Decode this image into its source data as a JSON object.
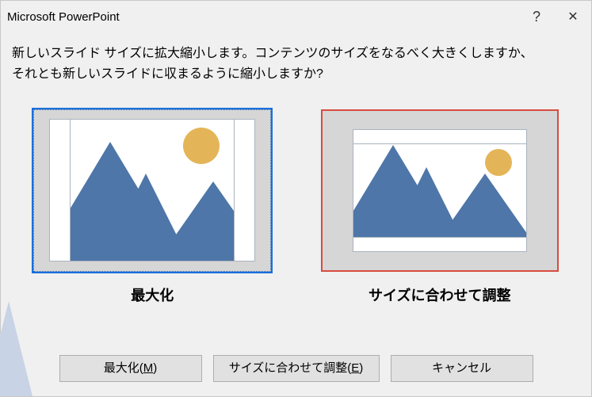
{
  "titlebar": {
    "title": "Microsoft PowerPoint",
    "help": "?",
    "close": "✕"
  },
  "message": "新しいスライド サイズに拡大縮小します。コンテンツのサイズをなるべく大きくしますか、\nそれとも新しいスライドに収まるように縮小しますか?",
  "options": {
    "maximize_label": "最大化",
    "ensure_fit_label": "サイズに合わせて調整"
  },
  "buttons": {
    "maximize": "最大化(M)",
    "ensure_fit": "サイズに合わせて調整(E)",
    "cancel": "キャンセル"
  }
}
